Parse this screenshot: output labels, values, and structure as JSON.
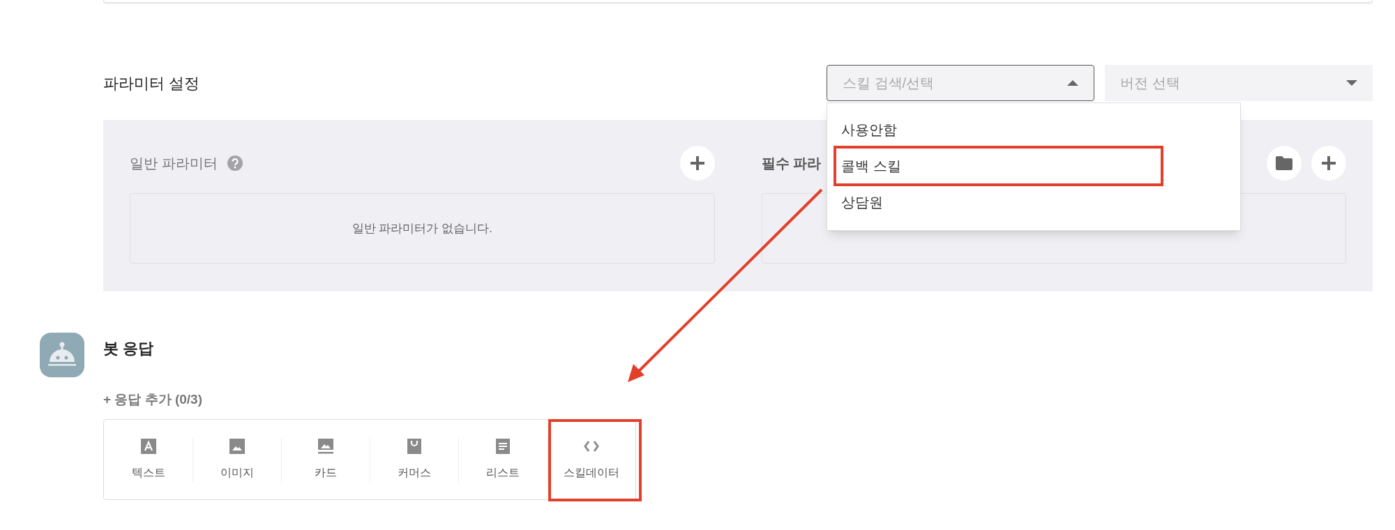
{
  "section_title": "파라미터 설정",
  "selects": [
    {
      "placeholder": "스킬 검색/선택",
      "expanded": true,
      "options": [
        {
          "label": "사용안함",
          "highlighted": false
        },
        {
          "label": "콜백 스킬",
          "highlighted": true
        },
        {
          "label": "상담원",
          "highlighted": false
        }
      ]
    },
    {
      "placeholder": "버전 선택",
      "expanded": false
    }
  ],
  "parameter_groups": [
    {
      "title": "일반 파라미터",
      "help": true,
      "folder_button": false,
      "empty_text": "일반 파라미터가 없습니다."
    },
    {
      "title": "필수 파라",
      "help": false,
      "folder_button": true
    }
  ],
  "bot_response": {
    "title": "봇 응답",
    "add_label": "+ 응답 추가 (0/3)",
    "types": [
      {
        "kind": "text",
        "label": "텍스트",
        "highlighted": false
      },
      {
        "kind": "image",
        "label": "이미지",
        "highlighted": false
      },
      {
        "kind": "card",
        "label": "카드",
        "highlighted": false
      },
      {
        "kind": "commerce",
        "label": "커머스",
        "highlighted": false
      },
      {
        "kind": "list",
        "label": "리스트",
        "highlighted": false
      },
      {
        "kind": "skilldata",
        "label": "스킬데이터",
        "highlighted": true
      }
    ]
  },
  "annotations": [
    {
      "kind": "arrow"
    }
  ]
}
